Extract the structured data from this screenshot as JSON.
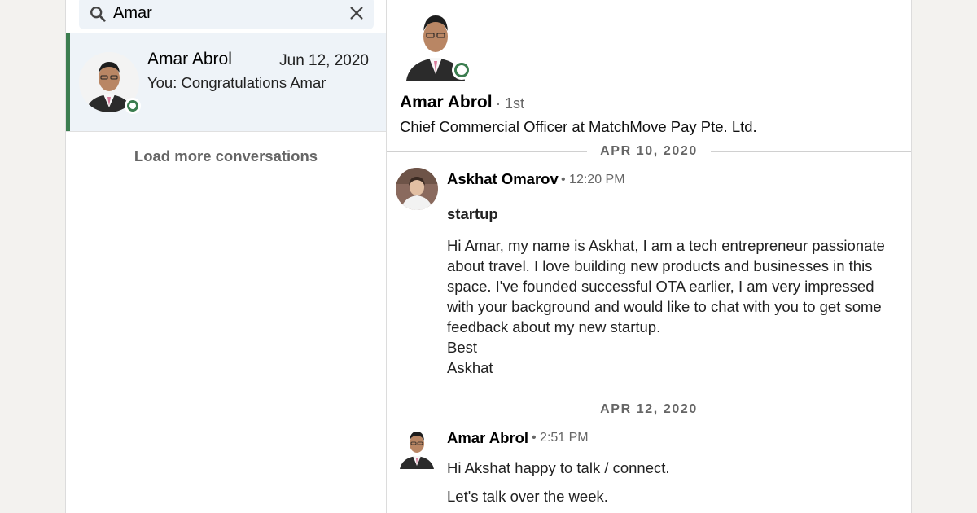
{
  "search": {
    "value": "Amar"
  },
  "conversation": {
    "name": "Amar Abrol",
    "date": "Jun 12, 2020",
    "snippet": "You: Congratulations Amar"
  },
  "load_more": "Load more conversations",
  "profile": {
    "name": "Amar Abrol",
    "degree": "· 1st",
    "headline": "Chief Commercial Officer at MatchMove Pay Pte. Ltd."
  },
  "thread": {
    "day1": "APR 10, 2020",
    "msg1": {
      "sender": "Askhat Omarov",
      "time": "• 12:20 PM",
      "subject": "startup",
      "body": "Hi Amar, my name is Askhat, I am a tech entrepreneur passionate\nabout travel. I love building new products and businesses in this\nspace. I've founded successful OTA earlier, I am very impressed\nwith your background and would like to chat with you to get some\nfeedback about my new startup.\nBest\nAskhat"
    },
    "day2": "APR 12, 2020",
    "msg2": {
      "sender": "Amar Abrol",
      "time": "• 2:51 PM",
      "line1": "Hi Akshat happy to talk / connect.",
      "line2": "Let's talk over the week."
    }
  },
  "colors": {
    "online": "#3b7d4f",
    "selected_bg": "#eef3f8",
    "page_bg": "#f3f2ef"
  },
  "icons": [
    "search-icon",
    "close-icon",
    "online-status-icon"
  ]
}
